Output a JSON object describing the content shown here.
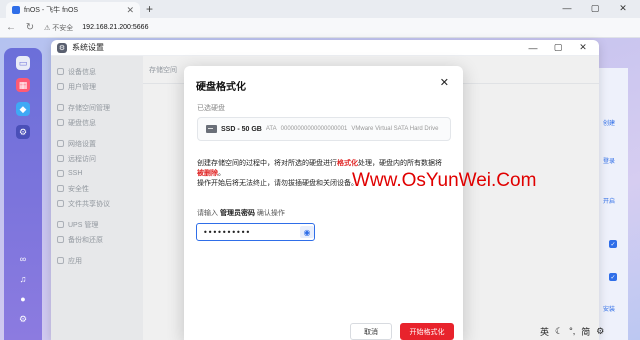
{
  "browser": {
    "tab_title": "fnOS - 飞牛 fnOS",
    "tab_close": "✕",
    "new_tab": "+",
    "security_label": "不安全",
    "url": "192.168.21.200:5666",
    "window_controls": [
      "—",
      "▢",
      "✕"
    ]
  },
  "window": {
    "title": "系统设置",
    "controls": [
      "—",
      "▢",
      "✕"
    ]
  },
  "sidebar": {
    "items": [
      {
        "label": "设备信息"
      },
      {
        "label": "用户管理"
      },
      {
        "label": "存储空间管理"
      },
      {
        "label": "硬盘信息"
      },
      {
        "label": "网络设置"
      },
      {
        "label": "远程访问"
      },
      {
        "label": "SSH"
      },
      {
        "label": "安全性"
      },
      {
        "label": "文件共享协议"
      },
      {
        "label": "UPS 管理"
      },
      {
        "label": "备份和还原"
      },
      {
        "label": "应用"
      }
    ]
  },
  "content": {
    "tab_label": "存储空间"
  },
  "right_strip": {
    "links": [
      "创建",
      "登录",
      "开启",
      "安装"
    ]
  },
  "modal": {
    "title": "硬盘格式化",
    "close": "✕",
    "selected_label": "已选硬盘",
    "disk": {
      "name": "SSD - 50 GB",
      "bus": "ATA",
      "serial": "00000000000000000001",
      "model": "VMware Virtual SATA Hard Drive"
    },
    "warning": {
      "part1": "创建存储空间的过程中，将对所选的硬盘进行",
      "highlight1": "格式化",
      "part2": "处理，硬盘内的所有数据将",
      "highlight2": "被删除",
      "part3": "。",
      "line2": "操作开始后将无法终止，请勿拔插硬盘和关闭设备。"
    },
    "password_prompt": {
      "prefix": "请输入",
      "bold": "管理员密码",
      "suffix": "确认操作"
    },
    "password_value": "••••••••••",
    "eye_icon": "◉",
    "cancel_label": "取消",
    "confirm_label": "开始格式化"
  },
  "watermark": "Www.OsYunWei.Com",
  "tray": {
    "ime": "英",
    "moon": "☾",
    "mode": "简"
  },
  "colors": {
    "accent": "#2f6ee8",
    "danger": "#e8232c",
    "dock": "#7b74dc"
  }
}
